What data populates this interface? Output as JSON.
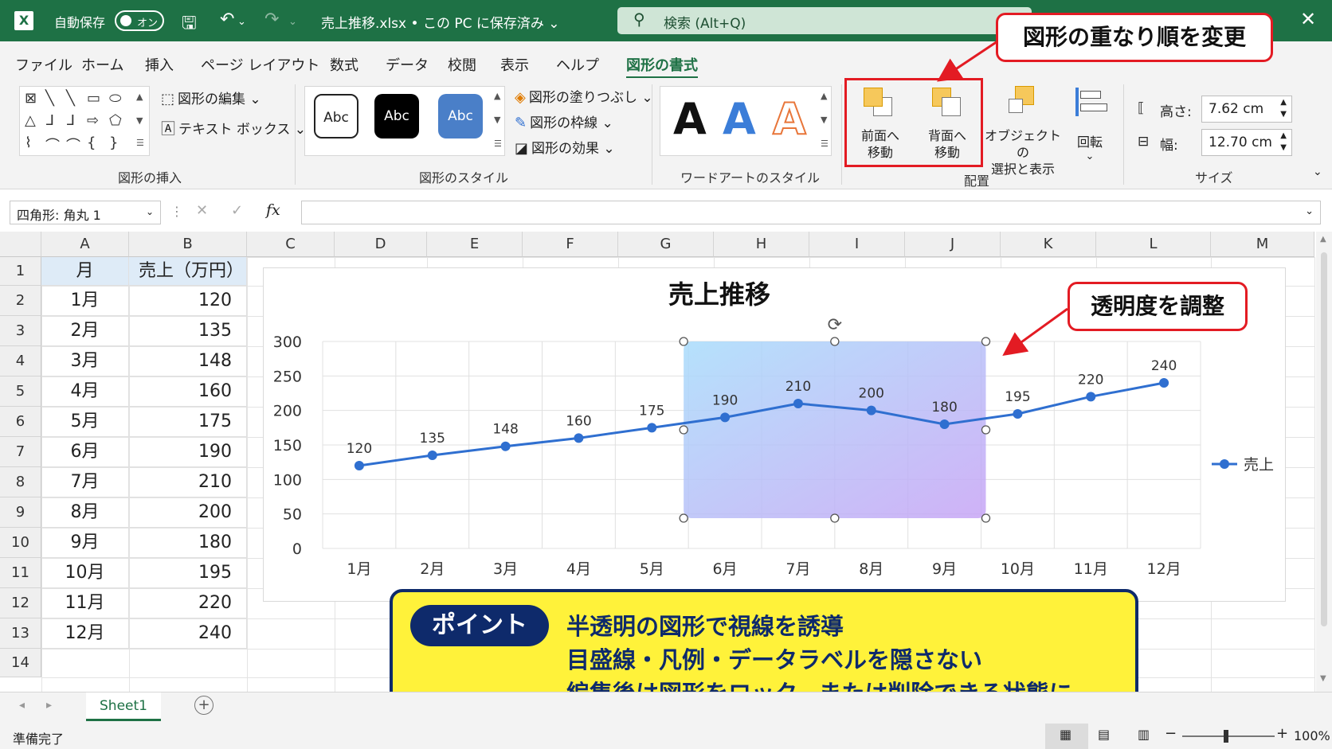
{
  "titlebar": {
    "autosave_label": "自動保存",
    "toggle_state": "オン",
    "document": "売上推移.xlsx • この PC に保存済み ⌄",
    "search_placeholder": "検索 (Alt+Q)",
    "close": "✕"
  },
  "menu": {
    "tabs": [
      "ファイル",
      "ホーム",
      "挿入",
      "ページ レイアウト",
      "数式",
      "データ",
      "校閲",
      "表示",
      "ヘルプ",
      "図形の書式"
    ],
    "active": "図形の書式"
  },
  "ribbon": {
    "insert_shapes": {
      "edit_shape": "図形の編集",
      "text_box": "テキスト ボックス",
      "group_label": "図形の挿入"
    },
    "shape_styles": {
      "sample": "Abc",
      "fill": "図形の塗りつぶし",
      "outline": "図形の枠線",
      "effects": "図形の効果",
      "group_label": "図形のスタイル"
    },
    "wordart": {
      "sample": "A",
      "group_label": "ワードアートのスタイル"
    },
    "arrange": {
      "bring_forward_1": "前面へ",
      "bring_forward_2": "移動",
      "send_backward_1": "背面へ",
      "send_backward_2": "移動",
      "selection_pane_1": "オブジェクトの",
      "selection_pane_2": "選択と表示",
      "rotate": "回転",
      "group_label": "配置"
    },
    "size": {
      "height_label": "高さ:",
      "height_value": "7.62 cm",
      "width_label": "幅:",
      "width_value": "12.70 cm",
      "group_label": "サイズ"
    }
  },
  "formula_bar": {
    "name_box": "四角形: 角丸 1",
    "cancel": "✕",
    "enter": "✓",
    "fx": "fx",
    "formula": ""
  },
  "grid": {
    "columns": [
      "A",
      "B",
      "C",
      "D",
      "E",
      "F",
      "G",
      "H",
      "I",
      "J",
      "K",
      "L",
      "M"
    ],
    "rows": [
      "1",
      "2",
      "3",
      "4",
      "5",
      "6",
      "7",
      "8",
      "9",
      "10",
      "11",
      "12",
      "13",
      "14"
    ],
    "header": {
      "month": "月",
      "sales": "売上（万円）"
    },
    "data": [
      {
        "month": "1月",
        "sales": "120"
      },
      {
        "month": "2月",
        "sales": "135"
      },
      {
        "month": "3月",
        "sales": "148"
      },
      {
        "month": "4月",
        "sales": "160"
      },
      {
        "month": "5月",
        "sales": "175"
      },
      {
        "month": "6月",
        "sales": "190"
      },
      {
        "month": "7月",
        "sales": "210"
      },
      {
        "month": "8月",
        "sales": "200"
      },
      {
        "month": "9月",
        "sales": "180"
      },
      {
        "month": "10月",
        "sales": "195"
      },
      {
        "month": "11月",
        "sales": "220"
      },
      {
        "month": "12月",
        "sales": "240"
      }
    ]
  },
  "chart_data": {
    "type": "line",
    "title": "売上推移",
    "categories": [
      "1月",
      "2月",
      "3月",
      "4月",
      "5月",
      "6月",
      "7月",
      "8月",
      "9月",
      "10月",
      "11月",
      "12月"
    ],
    "series": [
      {
        "name": "売上",
        "values": [
          120,
          135,
          148,
          160,
          175,
          190,
          210,
          200,
          180,
          195,
          220,
          240
        ],
        "color": "#2f6fd0"
      }
    ],
    "yticks": [
      "0",
      "50",
      "100",
      "150",
      "200",
      "250",
      "300"
    ],
    "ylim": [
      0,
      300
    ],
    "grid": true,
    "legend": "right",
    "overlay_shape": {
      "from_category": "6月",
      "to_category": "10月",
      "y_range": [
        0,
        300
      ],
      "colors": [
        "#a8dcfb",
        "#c7a4f5"
      ]
    }
  },
  "callouts": {
    "order": "図形の重なり順を変更",
    "transparency": "透明度を調整"
  },
  "point": {
    "badge": "ポイント",
    "lines": [
      "半透明の図形で視線を誘導",
      "目盛線・凡例・データラベルを隠さない",
      "編集後は図形をロック、または削除できる状態に"
    ]
  },
  "sheet_tabs": {
    "active": "Sheet1",
    "add": "+"
  },
  "status": {
    "ready": "準備完了",
    "zoom": "100%"
  },
  "colors": {
    "excel_green": "#1e7145",
    "callout_red": "#e31b23",
    "point_yellow": "#fff23a",
    "point_navy": "#0e2a6b"
  }
}
